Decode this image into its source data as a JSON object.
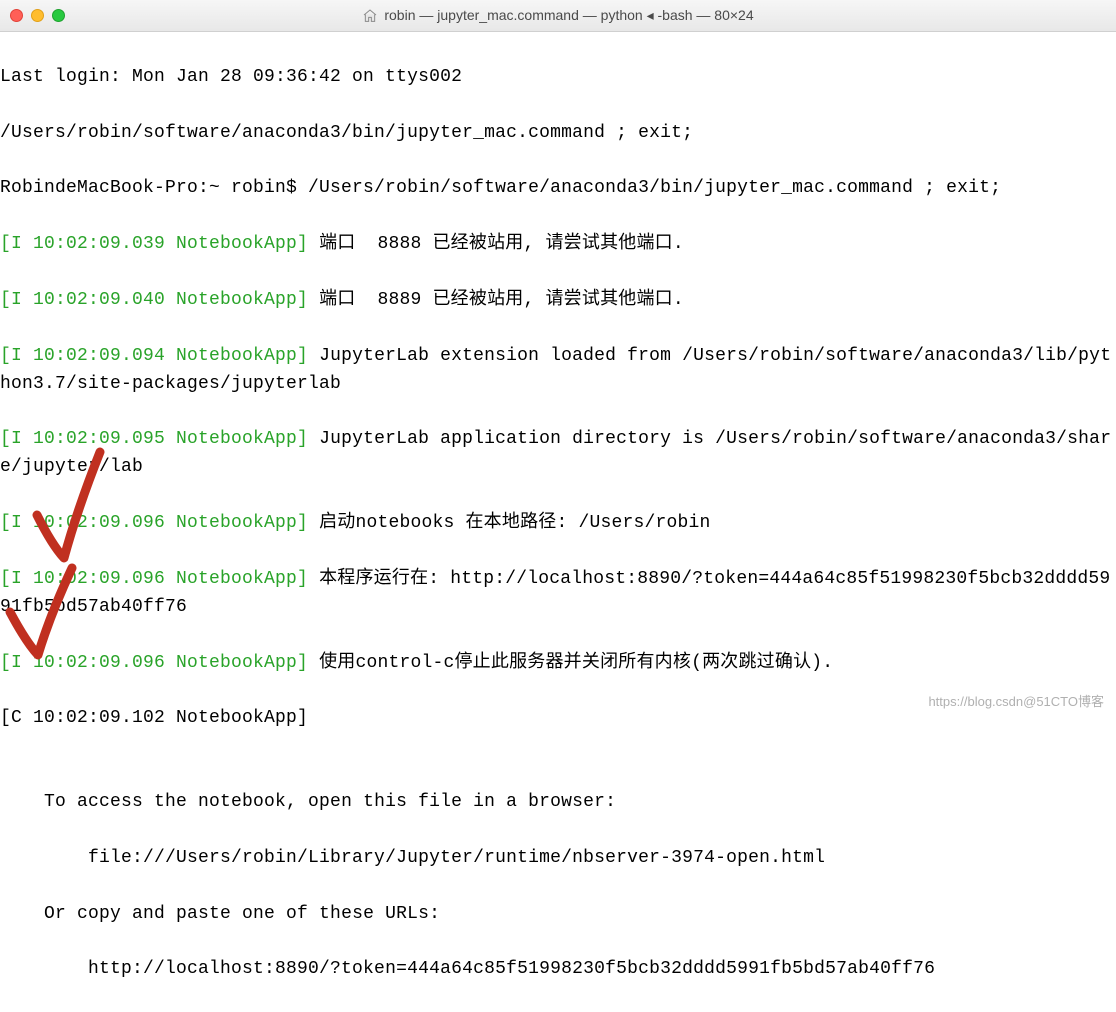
{
  "titlebar": {
    "title": "robin — jupyter_mac.command — python ◂ -bash — 80×24"
  },
  "lines": {
    "l1": "Last login: Mon Jan 28 09:36:42 on ttys002",
    "l2": "/Users/robin/software/anaconda3/bin/jupyter_mac.command ; exit;",
    "l3": "RobindeMacBook-Pro:~ robin$ /Users/robin/software/anaconda3/bin/jupyter_mac.command ; exit;",
    "tag1": "[I 10:02:09.039 NotebookApp]",
    "m1": " 端口  8888 已经被站用, 请尝试其他端口.",
    "tag2": "[I 10:02:09.040 NotebookApp]",
    "m2": " 端口  8889 已经被站用, 请尝试其他端口.",
    "tag3": "[I 10:02:09.094 NotebookApp]",
    "m3": " JupyterLab extension loaded from /Users/robin/software/anaconda3/lib/python3.7/site-packages/jupyterlab",
    "tag4": "[I 10:02:09.095 NotebookApp]",
    "m4": " JupyterLab application directory is /Users/robin/software/anaconda3/share/jupyter/lab",
    "tag5": "[I 10:02:09.096 NotebookApp]",
    "m5": " 启动notebooks 在本地路径: /Users/robin",
    "tag6": "[I 10:02:09.096 NotebookApp]",
    "m6": " 本程序运行在: http://localhost:8890/?token=444a64c85f51998230f5bcb32dddd5991fb5bd57ab40ff76",
    "tag7": "[I 10:02:09.096 NotebookApp]",
    "m7": " 使用control-c停止此服务器并关闭所有内核(两次跳过确认).",
    "l8": "[C 10:02:09.102 NotebookApp]",
    "l9": "",
    "l10": "    To access the notebook, open this file in a browser:",
    "l11": "        file:///Users/robin/Library/Jupyter/runtime/nbserver-3974-open.html",
    "l12": "    Or copy and paste one of these URLs:",
    "l13": "        http://localhost:8890/?token=444a64c85f51998230f5bcb32dddd5991fb5bd57ab40ff76"
  },
  "watermark": "https://blog.csdn@51CTO博客"
}
